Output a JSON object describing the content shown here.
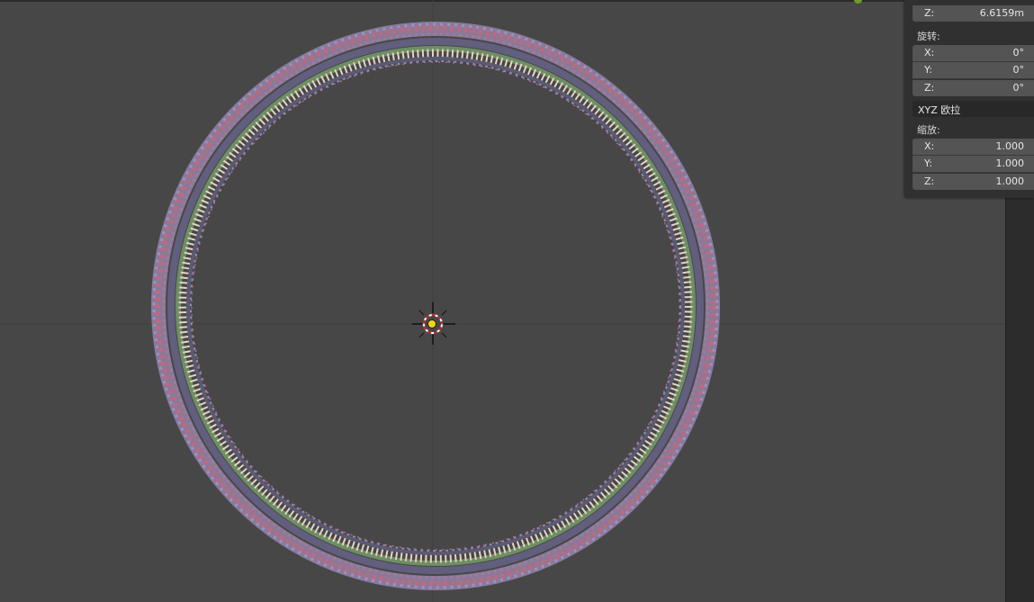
{
  "panel": {
    "location_z": {
      "axis": "Z:",
      "value": "6.6159m"
    },
    "rotation": {
      "label": "旋转:",
      "x": {
        "axis": "X:",
        "value": "0°"
      },
      "y": {
        "axis": "Y:",
        "value": "0°"
      },
      "z": {
        "axis": "Z:",
        "value": "0°"
      }
    },
    "rotation_mode": "XYZ 欧拉",
    "scale": {
      "label": "缩放:",
      "x": {
        "axis": "X:",
        "value": "1.000"
      },
      "y": {
        "axis": "Y:",
        "value": "1.000"
      },
      "z": {
        "axis": "Z:",
        "value": "1.000"
      }
    }
  },
  "viewport": {
    "background_color": "#474747",
    "grid_color": "#3e3e3e",
    "ring_colors": {
      "outer_pink": "#b86a80",
      "outer_blue": "#8f90c8",
      "mid_purple": "#6c6788",
      "green_band": "#6f8f63",
      "cream_ticks": "#e6d2c6",
      "inner_dark": "#55546a"
    },
    "icons": [
      "3d-cursor-icon",
      "object-origin-icon"
    ]
  }
}
